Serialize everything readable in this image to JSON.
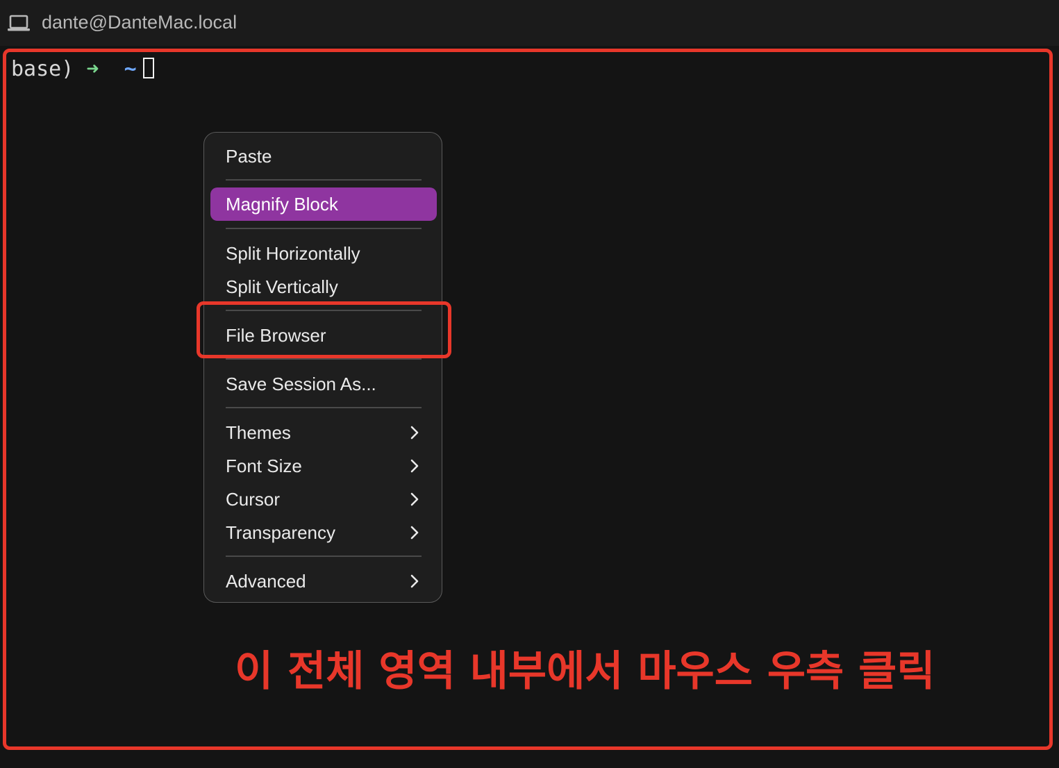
{
  "window": {
    "title": "dante@DanteMac.local",
    "icon": "laptop-icon"
  },
  "terminal": {
    "prompt_prefix": "base)",
    "prompt_arrow": "➜",
    "prompt_dir": "~"
  },
  "context_menu": {
    "items": [
      {
        "label": "Paste",
        "submenu": false,
        "highlighted": false
      },
      {
        "label": "Magnify Block",
        "submenu": false,
        "highlighted": true
      },
      {
        "label": "Split Horizontally",
        "submenu": false,
        "highlighted": false
      },
      {
        "label": "Split Vertically",
        "submenu": false,
        "highlighted": false
      },
      {
        "label": "File Browser",
        "submenu": false,
        "highlighted": false
      },
      {
        "label": "Save Session As...",
        "submenu": false,
        "highlighted": false
      },
      {
        "label": "Themes",
        "submenu": true,
        "highlighted": false
      },
      {
        "label": "Font Size",
        "submenu": true,
        "highlighted": false
      },
      {
        "label": "Cursor",
        "submenu": true,
        "highlighted": false
      },
      {
        "label": "Transparency",
        "submenu": true,
        "highlighted": false
      },
      {
        "label": "Advanced",
        "submenu": true,
        "highlighted": false
      }
    ],
    "highlight_color": "#8f35a0"
  },
  "annotation": {
    "text": "이 전체 영역 내부에서 마우스 우측 클릭",
    "color": "#e8372a"
  }
}
